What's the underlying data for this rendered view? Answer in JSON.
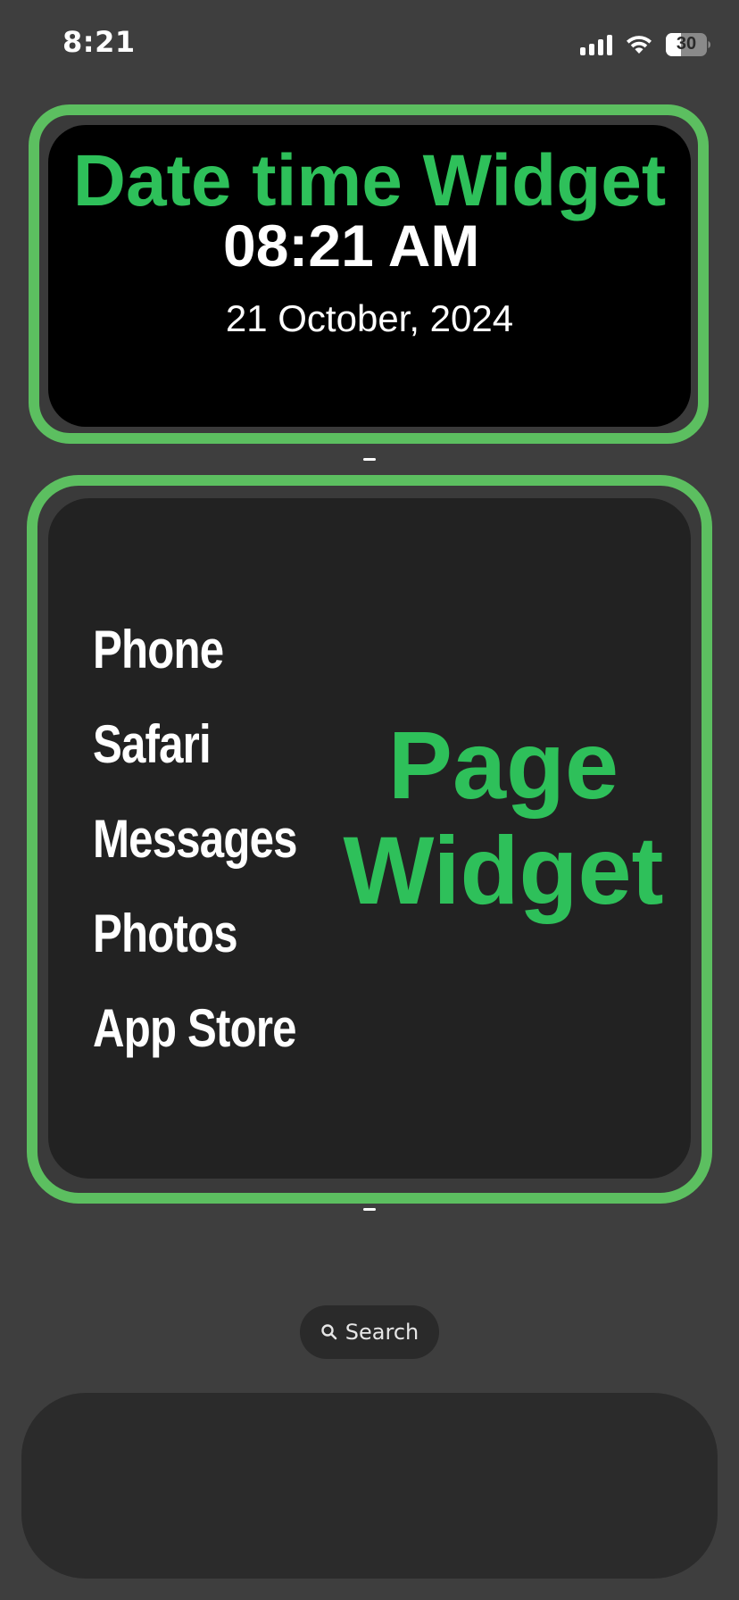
{
  "status_bar": {
    "time": "8:21",
    "battery": "30"
  },
  "datetime_widget": {
    "title": "Date time Widget",
    "time": "08:21 AM",
    "date": "21 October, 2024"
  },
  "page_widget": {
    "apps": [
      "Phone",
      "Safari",
      "Messages",
      "Photos",
      "App Store"
    ],
    "title_line1": "Page",
    "title_line2": "Widget"
  },
  "search": {
    "label": "Search"
  },
  "colors": {
    "accent_green": "#2ec05a",
    "outline_green": "#5cbf60",
    "background": "#3e3e3e"
  },
  "icons": {
    "signal": "cellular-signal-icon",
    "wifi": "wifi-icon",
    "battery": "battery-icon",
    "search": "magnifier-icon"
  }
}
